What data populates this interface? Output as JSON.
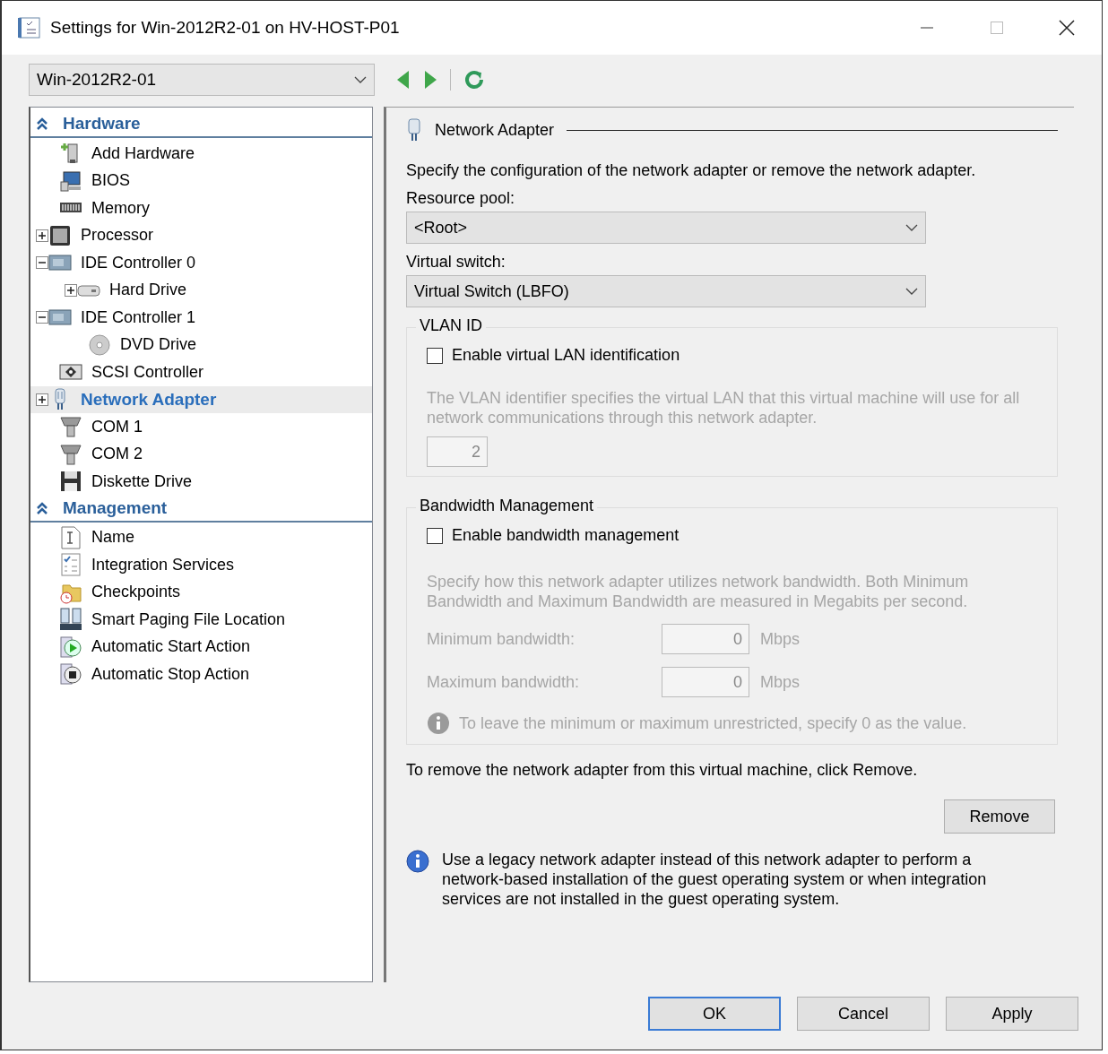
{
  "window": {
    "title": "Settings for Win-2012R2-01 on HV-HOST-P01"
  },
  "vm_selector": {
    "value": "Win-2012R2-01"
  },
  "tree": [
    {
      "label": "Hardware",
      "expanded": true,
      "items": [
        {
          "label": "Add Hardware",
          "kind": "add-hardware",
          "selected": false
        },
        {
          "label": "BIOS",
          "kind": "bios",
          "selected": false
        },
        {
          "label": "Memory",
          "kind": "memory",
          "selected": false
        },
        {
          "label": "Processor",
          "kind": "processor",
          "expanded": false,
          "selected": false
        },
        {
          "label": "IDE Controller 0",
          "kind": "controller",
          "expanded": true,
          "selected": false,
          "children": [
            {
              "label": "Hard Drive",
              "kind": "hard-drive",
              "expanded": false,
              "selected": false
            }
          ]
        },
        {
          "label": "IDE Controller 1",
          "kind": "controller",
          "expanded": true,
          "selected": false,
          "children": [
            {
              "label": "DVD Drive",
              "kind": "dvd",
              "selected": false
            }
          ]
        },
        {
          "label": "SCSI Controller",
          "kind": "scsi",
          "selected": false
        },
        {
          "label": "Network Adapter",
          "kind": "network",
          "expanded": false,
          "selected": true
        },
        {
          "label": "COM 1",
          "kind": "com",
          "selected": false
        },
        {
          "label": "COM 2",
          "kind": "com",
          "selected": false
        },
        {
          "label": "Diskette Drive",
          "kind": "diskette",
          "selected": false
        }
      ]
    },
    {
      "label": "Management",
      "expanded": true,
      "items": [
        {
          "label": "Name",
          "kind": "name",
          "selected": false
        },
        {
          "label": "Integration Services",
          "kind": "checklist",
          "selected": false
        },
        {
          "label": "Checkpoints",
          "kind": "checkpoint",
          "selected": false
        },
        {
          "label": "Smart Paging File Location",
          "kind": "paging",
          "selected": false
        },
        {
          "label": "Automatic Start Action",
          "kind": "start",
          "selected": false
        },
        {
          "label": "Automatic Stop Action",
          "kind": "stop",
          "selected": false
        }
      ]
    }
  ],
  "panel": {
    "title": "Network Adapter",
    "description": "Specify the configuration of the network adapter or remove the network adapter.",
    "resource_pool": {
      "label": "Resource pool:",
      "value": "<Root>"
    },
    "virtual_switch": {
      "label": "Virtual switch:",
      "value": "Virtual Switch (LBFO)"
    },
    "vlan": {
      "legend": "VLAN ID",
      "checkbox": {
        "label": "Enable virtual LAN identification",
        "checked": false
      },
      "disabled": true,
      "note": "The VLAN identifier specifies the virtual LAN that this virtual machine will use for all network communications through this network adapter.",
      "vlan_id": "2"
    },
    "bandwidth": {
      "legend": "Bandwidth Management",
      "checkbox": {
        "label": "Enable bandwidth management",
        "checked": false
      },
      "disabled": true,
      "note": "Specify how this network adapter utilizes network bandwidth. Both Minimum Bandwidth and Maximum Bandwidth are measured in Megabits per second.",
      "fields": [
        {
          "label": "Minimum bandwidth:",
          "value": "0",
          "unit": "Mbps"
        },
        {
          "label": "Maximum bandwidth:",
          "value": "0",
          "unit": "Mbps"
        }
      ],
      "hint": "To leave the minimum or maximum unrestricted, specify 0 as the value."
    },
    "remove_note": "To remove the network adapter from this virtual machine, click Remove.",
    "remove_button": "Remove",
    "legacy_note": "Use a legacy network adapter instead of this network adapter to perform a network-based installation of the guest operating system or when integration services are not installed in the guest operating system."
  },
  "buttons": [
    {
      "label": "OK",
      "default": true
    },
    {
      "label": "Cancel",
      "default": false
    },
    {
      "label": "Apply",
      "default": false
    }
  ]
}
